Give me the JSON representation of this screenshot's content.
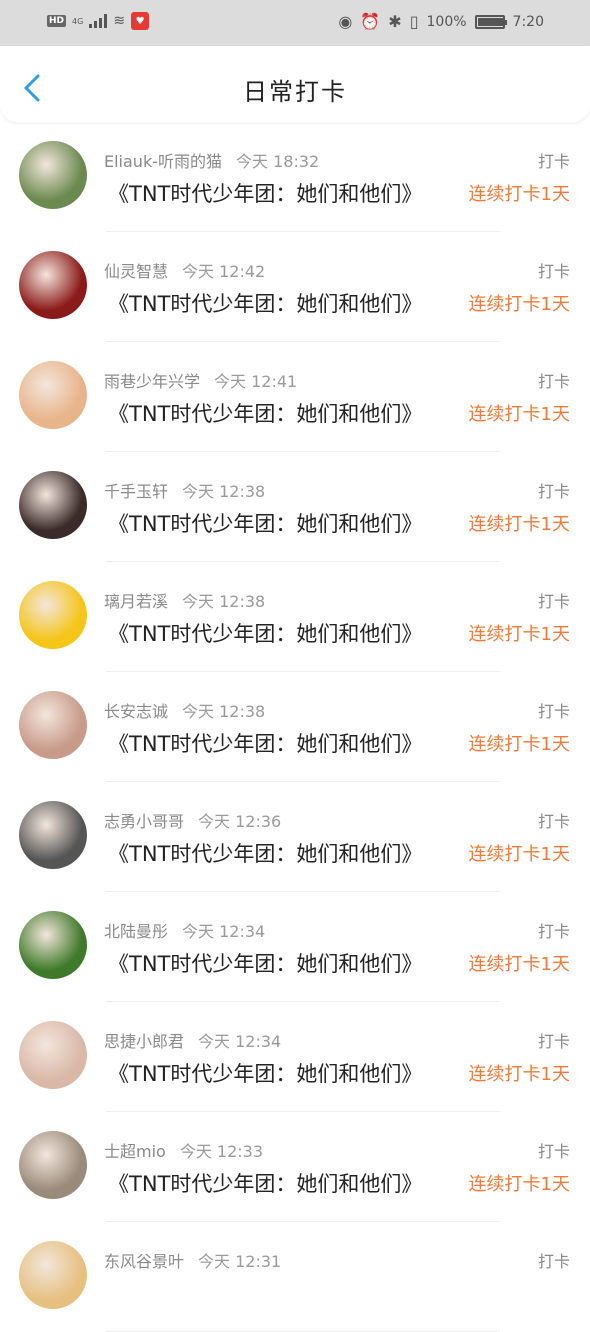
{
  "status": {
    "hd": "HD",
    "network": "4G",
    "battery_text": "100%",
    "time": "7:20",
    "battery_level": 1.0
  },
  "header": {
    "title": "日常打卡"
  },
  "colors": {
    "accent": "#2a9df4",
    "streak": "#f07a3a"
  },
  "items": [
    {
      "name": "Eliauk-听雨的猫",
      "time": "今天 18:32",
      "book": "《TNT时代少年团：她们和他们》",
      "tag": "打卡",
      "streak": "连续打卡1天",
      "avatar_color": "#6b8a4f"
    },
    {
      "name": "仙灵智慧",
      "time": "今天 12:42",
      "book": "《TNT时代少年团：她们和他们》",
      "tag": "打卡",
      "streak": "连续打卡1天",
      "avatar_color": "#8b1a1a"
    },
    {
      "name": "雨巷少年兴学",
      "time": "今天 12:41",
      "book": "《TNT时代少年团：她们和他们》",
      "tag": "打卡",
      "streak": "连续打卡1天",
      "avatar_color": "#e8b48a"
    },
    {
      "name": "千手玉轩",
      "time": "今天 12:38",
      "book": "《TNT时代少年团：她们和他们》",
      "tag": "打卡",
      "streak": "连续打卡1天",
      "avatar_color": "#3a2a2a"
    },
    {
      "name": "璃月若溪",
      "time": "今天 12:38",
      "book": "《TNT时代少年团：她们和他们》",
      "tag": "打卡",
      "streak": "连续打卡1天",
      "avatar_color": "#f5c518"
    },
    {
      "name": "长安志诚",
      "time": "今天 12:38",
      "book": "《TNT时代少年团：她们和他们》",
      "tag": "打卡",
      "streak": "连续打卡1天",
      "avatar_color": "#c89a8a"
    },
    {
      "name": "志勇小哥哥",
      "time": "今天 12:36",
      "book": "《TNT时代少年团：她们和他们》",
      "tag": "打卡",
      "streak": "连续打卡1天",
      "avatar_color": "#555555"
    },
    {
      "name": "北陆曼彤",
      "time": "今天 12:34",
      "book": "《TNT时代少年团：她们和他们》",
      "tag": "打卡",
      "streak": "连续打卡1天",
      "avatar_color": "#3f7a2a"
    },
    {
      "name": "思捷小郎君",
      "time": "今天 12:34",
      "book": "《TNT时代少年团：她们和他们》",
      "tag": "打卡",
      "streak": "连续打卡1天",
      "avatar_color": "#d9b8a8"
    },
    {
      "name": "士超mio",
      "time": "今天 12:33",
      "book": "《TNT时代少年团：她们和他们》",
      "tag": "打卡",
      "streak": "连续打卡1天",
      "avatar_color": "#9a8a7a"
    },
    {
      "name": "东风谷景叶",
      "time": "今天 12:31",
      "book": "",
      "tag": "打卡",
      "streak": "",
      "avatar_color": "#e6c080"
    }
  ]
}
